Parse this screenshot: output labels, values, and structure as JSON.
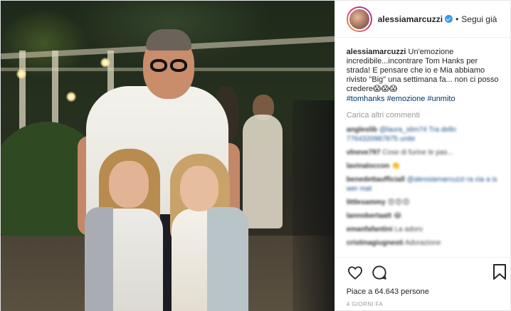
{
  "post": {
    "image_alt": "Photo",
    "author": {
      "username": "alessiamarcuzzi",
      "verified": true,
      "follow_separator": "•",
      "follow_label": "Segui già"
    },
    "caption": {
      "username": "alessiamarcuzzi",
      "text": "Un'emozione incredibile...incontrare Tom Hanks per strada! E pensare che io e Mia abbiamo rivisto \"Big\" una settimana fa... non ci posso credere😱😱😱",
      "hashtags": [
        "#tomhanks",
        "#emozione",
        "#unmito"
      ]
    },
    "load_more_label": "Carica altri commenti",
    "blurred_comments": [
      {
        "user": "angleslib",
        "text": "@laura_slim74 Tra dello 7764320987875 unite"
      },
      {
        "user": "vlneve797",
        "text": "Cose di furine le pas..."
      },
      {
        "user": "lavinaloccon",
        "text": "👏"
      },
      {
        "user": "benedettaufficiall",
        "text": "@alessiamarcuzzi ra cia a is wer mat"
      },
      {
        "user": "littlesammy",
        "text": "😍😍😍"
      },
      {
        "user": "lannobertaatt",
        "text": "😂"
      },
      {
        "user": "emanfafantini",
        "text": "La adoro"
      },
      {
        "user": "cristinagiugnesti",
        "text": "Adorazione"
      }
    ],
    "likes_label": "Piace a 64.643 persone",
    "timestamp": "4 GIORNI FA",
    "icons": {
      "like": "heart-icon",
      "comment": "comment-icon",
      "save": "bookmark-icon"
    }
  }
}
